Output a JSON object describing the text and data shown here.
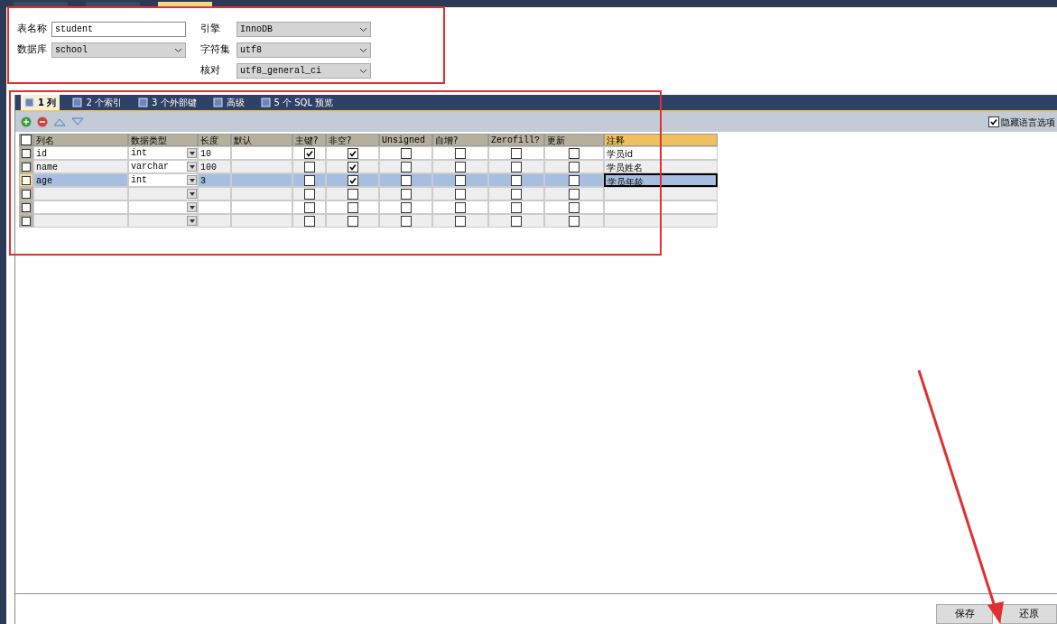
{
  "doc_tabs": [
    {
      "selected": false
    },
    {
      "selected": false
    },
    {
      "selected": true
    }
  ],
  "form": {
    "table_name": {
      "label": "表名称",
      "value": "student"
    },
    "database": {
      "label": "数据库",
      "value": "school"
    },
    "engine": {
      "label": "引擎",
      "value": "InnoDB"
    },
    "charset": {
      "label": "字符集",
      "value": "utf8"
    },
    "collation": {
      "label": "核对",
      "value": "utf8_general_ci"
    }
  },
  "tabs": [
    {
      "label": "1 列",
      "selected": true
    },
    {
      "label": "2 个索引",
      "selected": false
    },
    {
      "label": "3 个外部键",
      "selected": false
    },
    {
      "label": "高级",
      "selected": false
    },
    {
      "label": "5 个 SQL 预览",
      "selected": false
    }
  ],
  "hide_language_options": {
    "label": "隐藏语言选项",
    "checked": true
  },
  "table": {
    "select_all_checked": false,
    "columns": [
      "列名",
      "数据类型",
      "长度",
      "默认",
      "主键?",
      "非空?",
      "Unsigned",
      "自增?",
      "Zerofill?",
      "更新",
      "注释"
    ],
    "rows": [
      {
        "name": "id",
        "type": "int",
        "length": "10",
        "default": "",
        "pk": true,
        "not_null": true,
        "unsigned": false,
        "auto": false,
        "zerofill": false,
        "update": false,
        "comment": "学员id",
        "selected": false
      },
      {
        "name": "name",
        "type": "varchar",
        "length": "100",
        "default": "",
        "pk": false,
        "not_null": true,
        "unsigned": false,
        "auto": false,
        "zerofill": false,
        "update": false,
        "comment": "学员姓名",
        "selected": false
      },
      {
        "name": "age",
        "type": "int",
        "length": "3",
        "default": "",
        "pk": false,
        "not_null": true,
        "unsigned": false,
        "auto": false,
        "zerofill": false,
        "update": false,
        "comment": "学员年龄",
        "selected": true
      },
      {
        "name": "",
        "type": "",
        "length": "",
        "default": "",
        "pk": false,
        "not_null": false,
        "unsigned": false,
        "auto": false,
        "zerofill": false,
        "update": false,
        "comment": "",
        "selected": false
      },
      {
        "name": "",
        "type": "",
        "length": "",
        "default": "",
        "pk": false,
        "not_null": false,
        "unsigned": false,
        "auto": false,
        "zerofill": false,
        "update": false,
        "comment": "",
        "selected": false
      },
      {
        "name": "",
        "type": "",
        "length": "",
        "default": "",
        "pk": false,
        "not_null": false,
        "unsigned": false,
        "auto": false,
        "zerofill": false,
        "update": false,
        "comment": "",
        "selected": false
      }
    ]
  },
  "buttons": [
    "保存",
    "还原"
  ]
}
